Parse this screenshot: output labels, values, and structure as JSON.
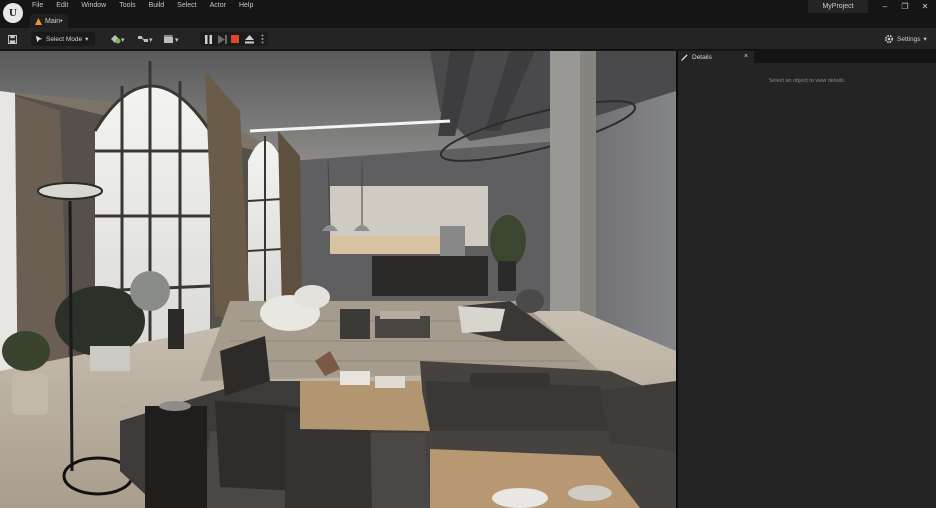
{
  "app": {
    "project_name": "MyProject",
    "level_tab": "Main•"
  },
  "menu": {
    "items": [
      "File",
      "Edit",
      "Window",
      "Tools",
      "Build",
      "Select",
      "Actor",
      "Help"
    ]
  },
  "window_controls": {
    "minimize": "–",
    "maximize": "❐",
    "close": "✕"
  },
  "toolbar": {
    "select_mode_label": "Select Mode",
    "settings_label": "Settings"
  },
  "details_panel": {
    "tab_label": "Details",
    "close_glyph": "×",
    "empty_message": "Select an object to view details."
  },
  "icons": {
    "logo": "unreal-logo-icon",
    "save": "save-icon",
    "select": "select-arrow-icon",
    "settings": "gear-icon"
  },
  "colors": {
    "title_bg": "#151515",
    "toolbar_bg": "#242424",
    "panel_bg": "#242424",
    "stop_red": "#e0452c",
    "level_orange": "#e59a2e"
  }
}
